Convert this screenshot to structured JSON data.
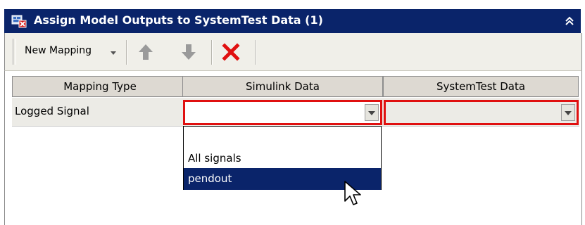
{
  "window": {
    "title": "Assign Model Outputs to SystemTest Data (1)",
    "title_bar_color": "#0a246a"
  },
  "toolbar": {
    "new_mapping_label": "New Mapping",
    "icons": [
      "move-up-arrow-icon",
      "move-down-arrow-icon",
      "delete-x-icon"
    ]
  },
  "grid": {
    "columns": [
      "Mapping Type",
      "Simulink Data",
      "SystemTest Data"
    ],
    "rows": [
      {
        "mapping_type": "Logged Signal",
        "simulink_data": "",
        "systemtest_data": ""
      }
    ],
    "error_border_color": "#e01010"
  },
  "dropdown": {
    "options": [
      "",
      "All signals",
      "pendout"
    ],
    "highlighted": "pendout"
  }
}
